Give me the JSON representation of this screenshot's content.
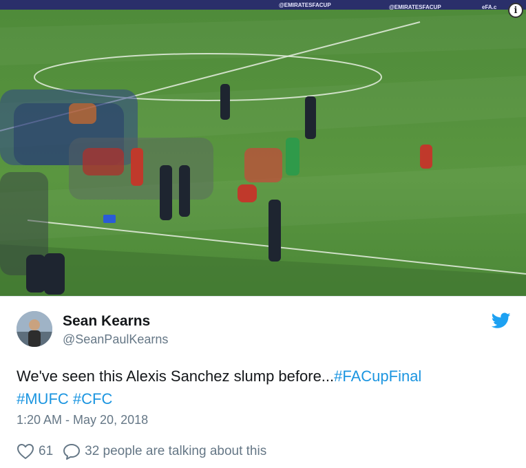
{
  "tweet": {
    "display_name": "Sean Kearns",
    "handle": "@SeanPaulKearns",
    "text_main": "We've seen this Alexis Sanchez slump before...",
    "hashtags": [
      "#FACupFinal",
      "#MUFC",
      "#CFC"
    ],
    "timestamp": "1:20 AM - May 20, 2018",
    "like_count": "61",
    "reply_text": "32 people are talking about this"
  },
  "media": {
    "info_glyph": "i",
    "board_text_1": "@EMIRATESFACUP",
    "board_text_2": "@EMIRATESFACUP",
    "board_text_3": "eFA.c"
  },
  "icons": {
    "bird": "twitter-bird-icon",
    "heart": "heart-icon",
    "reply": "speech-bubble-icon",
    "info": "info-icon"
  },
  "colors": {
    "link": "#1b95e0",
    "muted": "#657786",
    "text": "#14171a"
  }
}
